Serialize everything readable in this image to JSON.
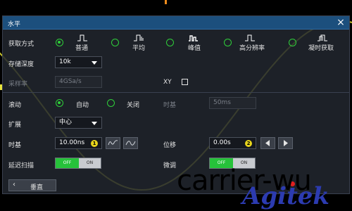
{
  "dialog": {
    "title": "水平",
    "close": "×"
  },
  "acquisition": {
    "label": "获取方式",
    "modes": [
      {
        "label": "普通",
        "icon": "normal-mode-icon",
        "selected": true
      },
      {
        "label": "平均",
        "icon": "average-mode-icon",
        "selected": false
      },
      {
        "label": "峰值",
        "icon": "peak-mode-icon",
        "selected": false
      },
      {
        "label": "高分辨率",
        "icon": "high-resolution-mode-icon",
        "selected": false
      },
      {
        "label": "凝时获取",
        "icon": "persistence-mode-icon",
        "selected": false
      }
    ]
  },
  "memory_depth": {
    "label": "存储深度",
    "value": "10k"
  },
  "sample_rate": {
    "label": "采样率",
    "value": "4GSa/s"
  },
  "xy": {
    "label": "XY",
    "checked": false
  },
  "roll": {
    "label": "滚动",
    "options": [
      {
        "label": "自动",
        "selected": true
      },
      {
        "label": "关闭",
        "selected": false
      }
    ],
    "timebase_label": "时基",
    "timebase_value": "50ms"
  },
  "expand": {
    "label": "扩展",
    "value": "中心"
  },
  "timebase": {
    "label": "时基",
    "value": "10.00ns",
    "knob": "1"
  },
  "position": {
    "label": "位移",
    "value": "0.00s",
    "knob": "2"
  },
  "delayed_scan": {
    "label": "延迟扫描",
    "off": "OFF",
    "on": "ON",
    "state": "OFF"
  },
  "fine": {
    "label": "微调",
    "off": "OFF",
    "on": "ON",
    "state": "OFF"
  },
  "back": {
    "label": "垂直"
  },
  "watermark": {
    "text": "carrier-wu",
    "logo": "Agitek"
  },
  "colors": {
    "accent": "#2fcf3a",
    "title_bar": "#1c4f7d",
    "trace": "#c8c42a",
    "knob": "#e8d51c"
  }
}
